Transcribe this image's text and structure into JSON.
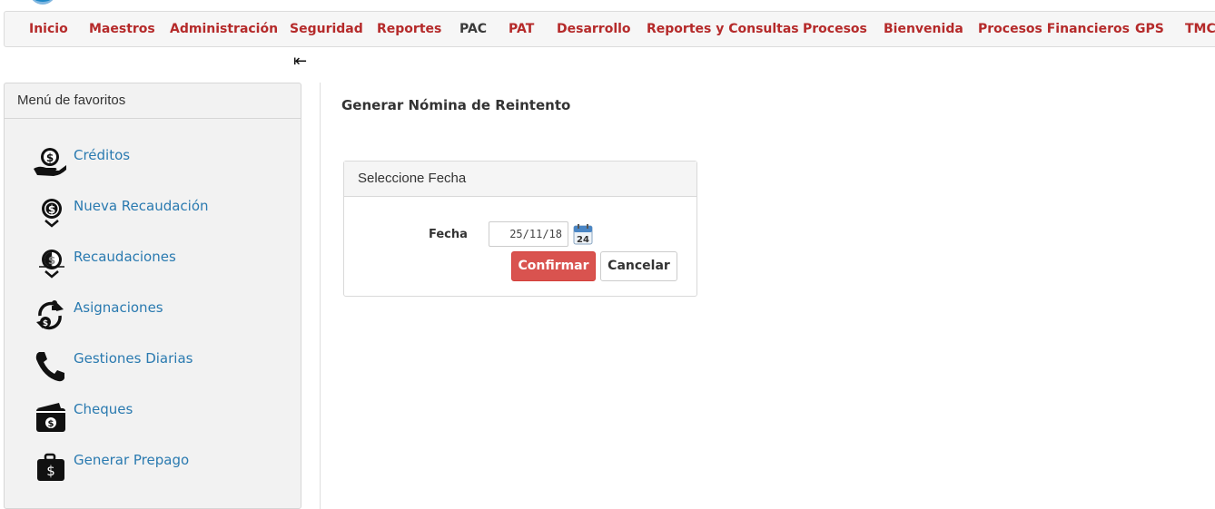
{
  "nav": {
    "items": [
      {
        "label": "Inicio"
      },
      {
        "label": "Maestros"
      },
      {
        "label": "Administración"
      },
      {
        "label": "Seguridad"
      },
      {
        "label": "Reportes"
      },
      {
        "label": "PAC"
      },
      {
        "label": "PAT"
      },
      {
        "label": "Desarrollo"
      },
      {
        "label": "Reportes y Consultas"
      },
      {
        "label": "Procesos"
      },
      {
        "label": "Bienvenida"
      },
      {
        "label": "Procesos Financieros"
      },
      {
        "label": "GPS"
      },
      {
        "label": "TMC"
      }
    ],
    "collapse_glyph": "⇤"
  },
  "favorites": {
    "title": "Menú de favoritos",
    "items": [
      {
        "label": "Créditos",
        "icon": "hand-money-icon"
      },
      {
        "label": "Nueva Recaudación",
        "icon": "coin-download-icon"
      },
      {
        "label": "Recaudaciones",
        "icon": "coin-download-icon"
      },
      {
        "label": "Asignaciones",
        "icon": "cycle-money-icon"
      },
      {
        "label": "Gestiones Diarias",
        "icon": "phone-icon"
      },
      {
        "label": "Cheques",
        "icon": "wallet-icon"
      },
      {
        "label": "Generar Prepago",
        "icon": "briefcase-money-icon"
      }
    ]
  },
  "main": {
    "title": "Generar Nómina de Reintento",
    "panel": {
      "title": "Seleccione Fecha",
      "date_label": "Fecha",
      "date_value": "25/11/18",
      "calendar_day": "24",
      "confirm_label": "Confirmar",
      "cancel_label": "Cancelar"
    }
  },
  "colors": {
    "nav_text": "#b52a2a",
    "link": "#2a7ab0",
    "confirm_bg": "#d9534f"
  }
}
